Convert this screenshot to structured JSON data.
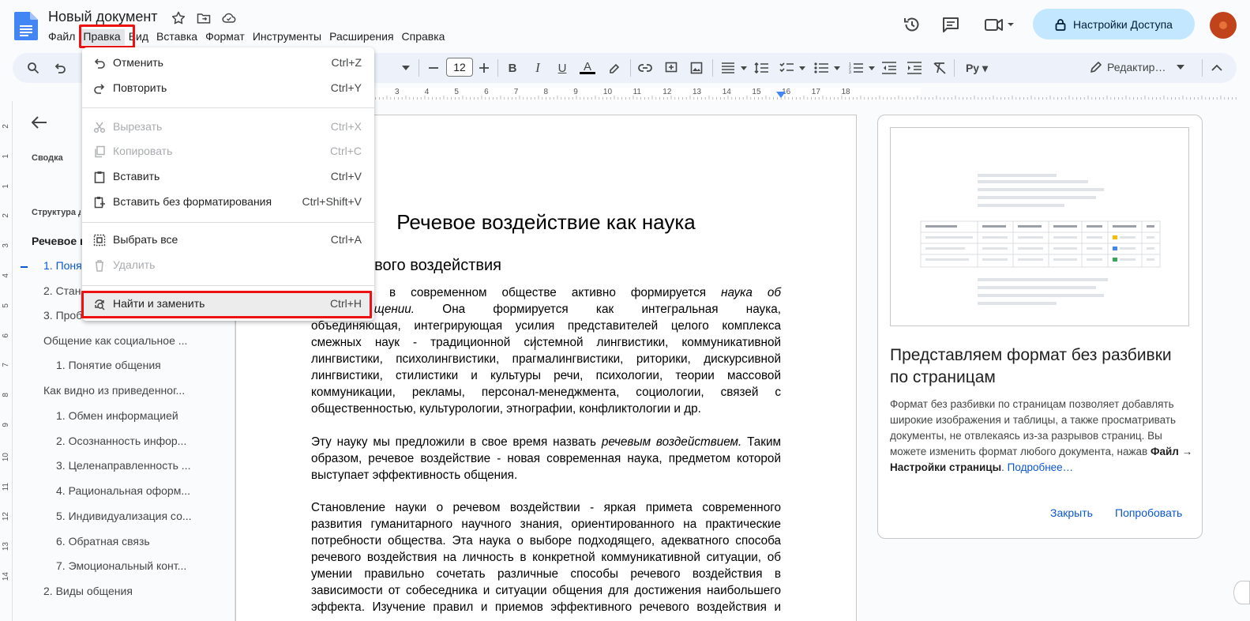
{
  "header": {
    "title": "Новый документ",
    "share_label": "Настройки Доступа",
    "menus": [
      "Файл",
      "Правка",
      "Вид",
      "Вставка",
      "Формат",
      "Инструменты",
      "Расширения",
      "Справка"
    ],
    "active_menu": "Правка"
  },
  "toolbar": {
    "font_size": "12",
    "mode_label": "Редактир…"
  },
  "ruler": {
    "numbers": [
      "3",
      "4",
      "5",
      "6",
      "7",
      "8",
      "9",
      "10",
      "11",
      "12",
      "13",
      "14",
      "15",
      "16",
      "17",
      "18"
    ]
  },
  "vruler": {
    "numbers": [
      "2",
      "1",
      "1",
      "2",
      "3",
      "4",
      "5",
      "6",
      "7",
      "8",
      "9",
      "10",
      "11",
      "12",
      "13",
      "14"
    ]
  },
  "outline": {
    "summary_label": "Сводка",
    "structure_label": "Структура д",
    "items": [
      {
        "label": "Речевое в",
        "level": 0
      },
      {
        "label": "1. Поня",
        "level": 1,
        "active": true
      },
      {
        "label": "2. Стан",
        "level": 1
      },
      {
        "label": "3. Проб",
        "level": 1
      },
      {
        "label": "Общение как социальное ...",
        "level": 1
      },
      {
        "label": "1. Понятие общения",
        "level": 2
      },
      {
        "label": "Как видно из приведенног...",
        "level": 1
      },
      {
        "label": "1. Обмен информацией",
        "level": 2
      },
      {
        "label": "2. Осознанность инфор...",
        "level": 2
      },
      {
        "label": "3. Целенаправленность ...",
        "level": 2
      },
      {
        "label": "4. Рациональная оформ...",
        "level": 2
      },
      {
        "label": "5. Индивидуализация со...",
        "level": 2
      },
      {
        "label": "6. Обратная связь",
        "level": 2
      },
      {
        "label": "7. Эмоциональный конт...",
        "level": 2
      },
      {
        "label": "2. Виды общения",
        "level": 1
      }
    ]
  },
  "document": {
    "title": "Речевое воздействие как наука",
    "heading": "тие речевого воздействия",
    "p1_lines": [
      {
        "pre": "ее время в современном обществе активно формируется ",
        "em": "наука об"
      },
      {
        "em": "ном общении.",
        "post": " Она формируется как интегральная наука,"
      },
      {
        "pre": "объединяющая, интегрирующая усилия представителей целого комплекса"
      },
      {
        "pre": "смежных наук - традиционной системной лингвистики, коммуникативной"
      },
      {
        "pre": "лингвистики, психолингвистики, прагмалингвистики, риторики, дискурсивной"
      },
      {
        "pre": "лингвистики, стилистики и культуры речи, психологии, теории массовой"
      },
      {
        "pre": "коммуникации, рекламы, персонал-менеджмента, социологии, связей с"
      },
      {
        "pre": "общественностью, культурологии, этнографии, конфликтологии и др.",
        "last": true
      }
    ],
    "p2_lines": [
      {
        "pre": "Эту науку мы предложили в свое время назвать ",
        "em": "речевым воздействием.",
        "post": " Таким"
      },
      {
        "pre": "образом, речевое воздействие - новая современная наука, предметом которой"
      },
      {
        "pre": "выступает эффективность общения.",
        "last": true
      }
    ],
    "p3_lines": [
      {
        "pre": "Становление науки о речевом воздействии - яркая примета современного"
      },
      {
        "pre": "развития гуманитарного научного знания, ориентированного на практические"
      },
      {
        "pre": "потребности общества. Эта наука о выборе подходящего, адекватного способа"
      },
      {
        "pre": "речевого воздействия на личность в конкретной коммуникативной ситуации, об"
      },
      {
        "pre": "умении правильно сочетать различные способы речевого воздействия в"
      },
      {
        "pre": "зависимости от собеседника и ситуации общения для достижения наибольшего"
      },
      {
        "pre": "эффекта. Изучение правил и приемов эффективного речевого воздействия и"
      }
    ]
  },
  "promo": {
    "title": "Представляем формат без разбивки по страницам",
    "body_pre": "Формат без разбивки по страницам позволяет добавлять широкие изображения и таблицы, а также просматривать документы, не отвлекаясь из-за разрывов страниц. Вы можете изменить формат любого документа, нажав ",
    "body_bold": "Файл → Настройки страницы",
    "body_post": ".",
    "link": "Подробнее…",
    "close_label": "Закрыть",
    "try_label": "Попробовать"
  },
  "edit_menu": {
    "items": [
      {
        "label": "Отменить",
        "shortcut": "Ctrl+Z",
        "icon": "undo-icon",
        "disabled": false
      },
      {
        "label": "Повторить",
        "shortcut": "Ctrl+Y",
        "icon": "redo-icon",
        "disabled": false
      },
      {
        "label": "Вырезать",
        "shortcut": "Ctrl+X",
        "icon": "scissors-icon",
        "disabled": true
      },
      {
        "label": "Копировать",
        "shortcut": "Ctrl+C",
        "icon": "copy-icon",
        "disabled": true
      },
      {
        "label": "Вставить",
        "shortcut": "Ctrl+V",
        "icon": "clipboard-icon",
        "disabled": false
      },
      {
        "label": "Вставить без форматирования",
        "shortcut": "Ctrl+Shift+V",
        "icon": "clipboard-plain-icon",
        "disabled": false
      },
      {
        "label": "Выбрать все",
        "shortcut": "Ctrl+A",
        "icon": "select-all-icon",
        "disabled": false
      },
      {
        "label": "Удалить",
        "shortcut": "",
        "icon": "trash-icon",
        "disabled": true
      },
      {
        "label": "Найти и заменить",
        "shortcut": "Ctrl+H",
        "icon": "find-replace-icon",
        "disabled": false,
        "highlighted": true
      }
    ]
  },
  "colors": {
    "accent": "#0b57d0",
    "share_bg": "#c2e7ff",
    "highlight_box": "#ee1111"
  }
}
